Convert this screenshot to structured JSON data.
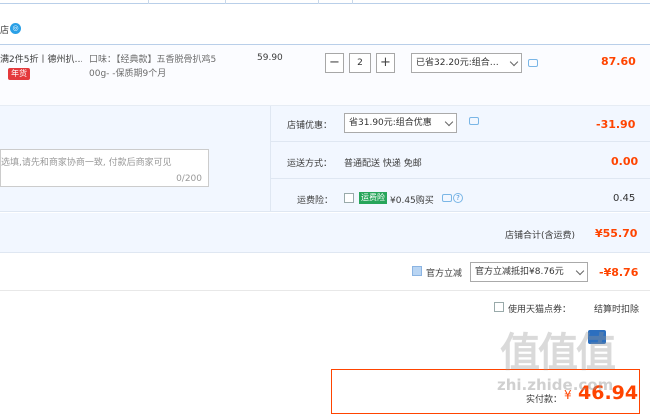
{
  "shop": {
    "store_fragment": "店"
  },
  "item": {
    "title_line1": "满2件5折丨德州扒…",
    "badge": "年货",
    "spec_line1": "口味：【经典款】五香脱骨扒鸡5",
    "spec_line2": "00g- -保质期9个月",
    "unit_price": "59.90",
    "qty": "2",
    "qty_minus": "−",
    "qty_plus": "+",
    "promo_select": "已省32.20元:组合…",
    "subtotal": "87.60"
  },
  "shop_discount": {
    "label": "店铺优惠：",
    "select": "省31.90元:组合优惠",
    "amount": "-31.90"
  },
  "message": {
    "placeholder": "选填,请先和商家协商一致, 付款后商家可见",
    "counter": "0/200"
  },
  "delivery": {
    "label": "运送方式：",
    "value": "普通配送 快递 免邮",
    "amount": "0.00"
  },
  "insurance": {
    "label": "运费险：",
    "tag": "运费险",
    "text": "¥0.45购买",
    "amount": "0.45"
  },
  "shop_total": {
    "label": "店铺合计(含运费)",
    "amount": "¥55.70"
  },
  "official_discount": {
    "checkbox_label": "官方立减",
    "select": "官方立减抵扣¥8.76元",
    "amount": "-¥8.76"
  },
  "points": {
    "label": "使用天猫点券：",
    "note": "结算时扣除"
  },
  "pay": {
    "label": "实付款：",
    "currency": "¥",
    "amount": "46.94"
  },
  "watermark": {
    "logo": "值值值",
    "url": "zhi.zhide.com"
  }
}
